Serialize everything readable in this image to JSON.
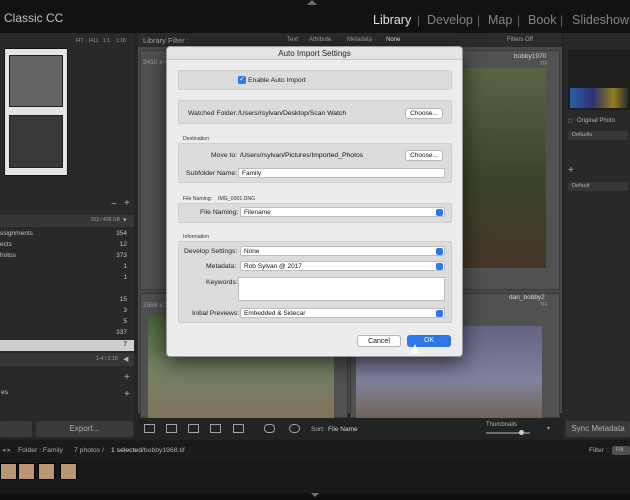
{
  "app": {
    "title": "Classic CC"
  },
  "modules": [
    {
      "label": "Library",
      "active": true
    },
    {
      "label": "Develop",
      "active": false
    },
    {
      "label": "Map",
      "active": false
    },
    {
      "label": "Book",
      "active": false
    },
    {
      "label": "Slideshow",
      "active": false
    }
  ],
  "navigator": {
    "zoom_options": [
      "FIT",
      "FILL",
      "1:1",
      "1:16"
    ]
  },
  "folders": {
    "volume_info": "103 / 499 GB",
    "rows": [
      {
        "name": "ssignments",
        "count": "354"
      },
      {
        "name": "ects",
        "count": "12"
      },
      {
        "name": "hotos",
        "count": "373"
      },
      {
        "name": "",
        "count": "1"
      },
      {
        "name": "",
        "count": "1"
      },
      {
        "name": "",
        "count": "15"
      },
      {
        "name": "",
        "count": "3"
      },
      {
        "name": "",
        "count": "5"
      },
      {
        "name": "",
        "count": "337"
      },
      {
        "name": "",
        "count": "7"
      }
    ],
    "collections_info": "1-4 / 2.16",
    "export_label": "Export...",
    "collapsed_label": "es"
  },
  "library_filter": {
    "label": "Library Filter :",
    "tabs": [
      "Text",
      "Attribute",
      "Metadata",
      "None"
    ],
    "filters_off": "Filters Off"
  },
  "grid": {
    "cell1_dim": "2410 x 4",
    "cell1_name": "bobby1970",
    "cell1_ext": "TIF",
    "cell2_dim": "2588 x 3",
    "cell2_name": "dan_bobby2",
    "cell2_ext": "TIF"
  },
  "right_panel": {
    "original_photo": "Original Photo",
    "defaults": "Defaults",
    "default": "Default",
    "sync_button": "Sync Metadata"
  },
  "toolbar": {
    "sort_label": "Sort:",
    "sort_value": "File Name",
    "thumbnails_label": "Thumbnails"
  },
  "filmbar": {
    "folder_text": "Folder : Family",
    "count_text": "7 photos /",
    "selected_text": "1 selected",
    "file_text": "/bobby1968.tif",
    "filter_label": "Filter :",
    "filter_value": "Filt"
  },
  "dialog": {
    "title": "Auto Import Settings",
    "enable_label": "Enable Auto Import",
    "enabled": true,
    "watched_label": "Watched Folder:",
    "watched_path": "/Users/rsylvan/Desktop/Scan Watch",
    "choose_label": "Choose...",
    "destination_header": "Destination",
    "move_to_label": "Move to:",
    "move_to_path": "/Users/rsylvan/Pictures/Imported_Photos",
    "subfolder_label": "Subfolder Name:",
    "subfolder_value": "Family",
    "file_naming_header": "File Naming:",
    "file_naming_example": "IMG_0001.DNG",
    "file_naming_label": "File Naming:",
    "file_naming_value": "Filename",
    "information_header": "Information",
    "develop_label": "Develop Settings:",
    "develop_value": "None",
    "metadata_label": "Metadata:",
    "metadata_value": "Rob Sylvan @ 2017",
    "keywords_label": "Keywords:",
    "keywords_value": "",
    "previews_label": "Initial Previews:",
    "previews_value": "Embedded & Sidecar",
    "cancel_label": "Cancel",
    "ok_label": "OK"
  },
  "colors": {
    "accent": "#2b78e6",
    "topbar": "#141414",
    "dialog_bg": "#ececec"
  }
}
